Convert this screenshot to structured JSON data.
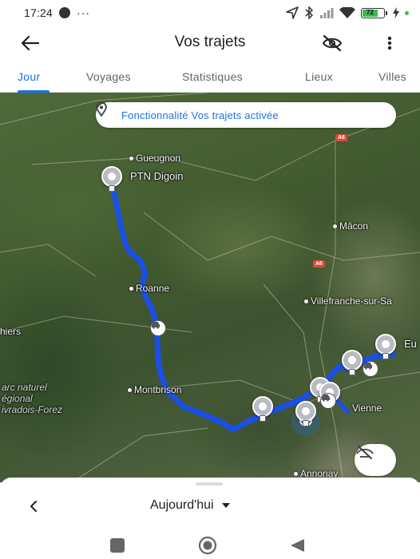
{
  "status_bar": {
    "time": "17:24",
    "dots": "···",
    "battery_level": "72",
    "icons": [
      "record-icon",
      "location-arrow-icon",
      "bluetooth-icon",
      "signal-icon",
      "wifi-icon",
      "battery-icon",
      "charging-icon"
    ]
  },
  "app_bar": {
    "title": "Vos trajets"
  },
  "tabs": [
    {
      "label": "Jour",
      "active": true
    },
    {
      "label": "Voyages",
      "active": false
    },
    {
      "label": "Statistiques",
      "active": false
    },
    {
      "label": "Lieux",
      "active": false
    },
    {
      "label": "Villes",
      "active": false
    }
  ],
  "map": {
    "banner": "Fonctionnalité Vos trajets activée",
    "labels": {
      "gueugnon": "Gueugnon",
      "digoin": "PTN Digoin",
      "roanne": "Roanne",
      "montbrison": "Montbrison",
      "macon": "Mâcon",
      "villefranche": "Villefranche-sur-Sa",
      "vienne": "Vienne",
      "annonay": "Annonay",
      "thiers": "hiers",
      "eu": "Eu",
      "parc1": "arc naturel",
      "parc2": "égional",
      "parc3": "ivradois-Forez"
    },
    "road_badges": [
      "A6",
      "A6"
    ],
    "route_color": "#1a4fe8"
  },
  "sheet": {
    "date": "Aujourd'hui"
  }
}
